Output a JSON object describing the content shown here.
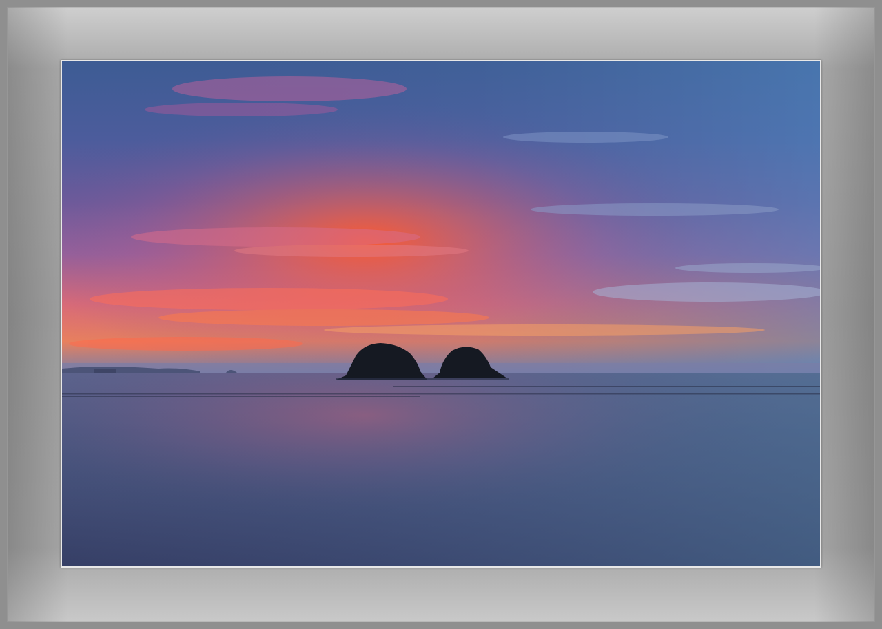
{
  "frame": {
    "outer_color": "#8f8f8f",
    "mat_color": "#a3a3a3",
    "border_color": "#e8e8e8"
  },
  "photo": {
    "subject": "sunset-seascape-islands",
    "colors": {
      "sky_top": "#3f5f96",
      "sky_mid": "#6a5a98",
      "sunset_glow": "#ff6a3a",
      "horizon_warm": "#f2a05a",
      "sea_dark": "#3b4a70",
      "sea_reflection": "#9a5a7a",
      "island_silhouette": "#161a22"
    }
  }
}
